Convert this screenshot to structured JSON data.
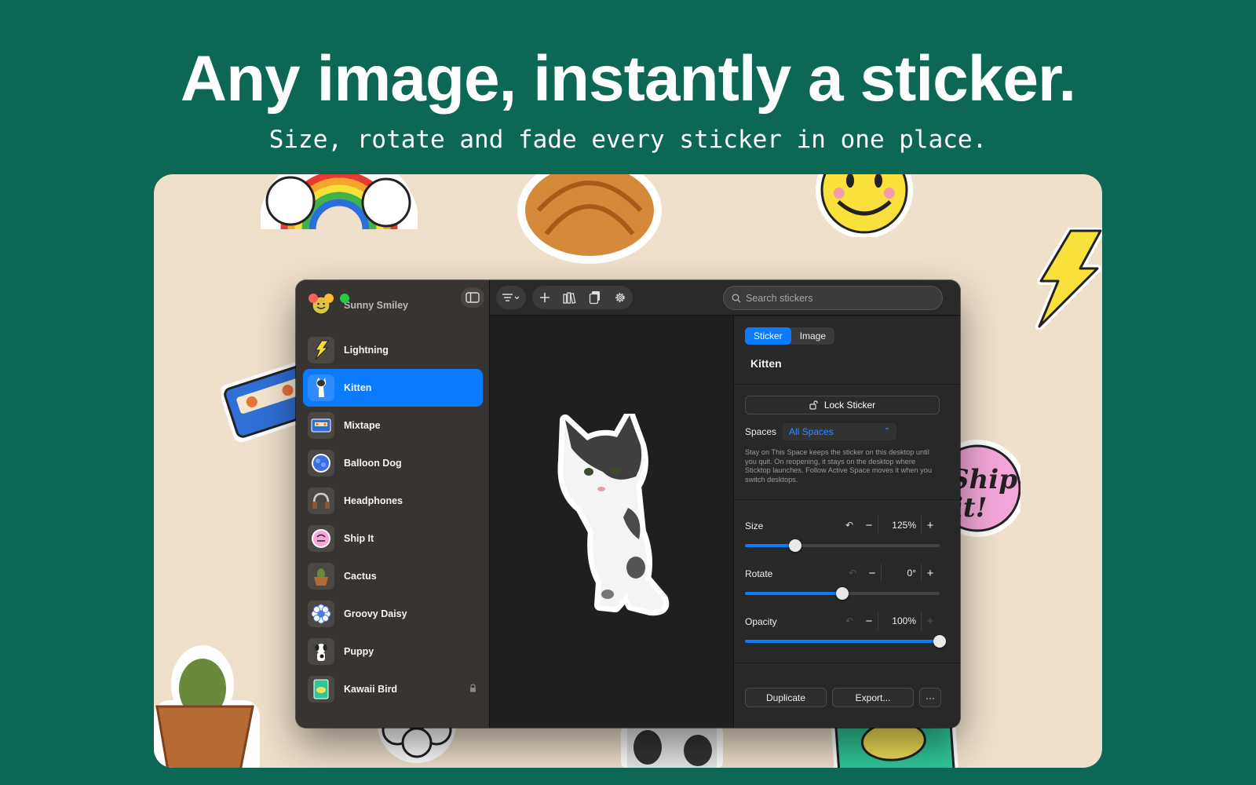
{
  "hero": {
    "headline": "Any image, instantly a sticker.",
    "subline": "Size, rotate and fade every sticker in one place."
  },
  "app": {
    "sidebar": {
      "items": [
        {
          "label": "Sunny Smiley",
          "icon": "smiley-icon",
          "active": false,
          "locked": false
        },
        {
          "label": "Lightning",
          "icon": "lightning-icon",
          "active": false,
          "locked": false
        },
        {
          "label": "Kitten",
          "icon": "kitten-icon",
          "active": true,
          "locked": false
        },
        {
          "label": "Mixtape",
          "icon": "cassette-icon",
          "active": false,
          "locked": false
        },
        {
          "label": "Balloon Dog",
          "icon": "balloon-dog-icon",
          "active": false,
          "locked": false
        },
        {
          "label": "Headphones",
          "icon": "headphones-icon",
          "active": false,
          "locked": false
        },
        {
          "label": "Ship It",
          "icon": "ship-it-icon",
          "active": false,
          "locked": false
        },
        {
          "label": "Cactus",
          "icon": "cactus-icon",
          "active": false,
          "locked": false
        },
        {
          "label": "Groovy Daisy",
          "icon": "daisy-icon",
          "active": false,
          "locked": false
        },
        {
          "label": "Puppy",
          "icon": "puppy-icon",
          "active": false,
          "locked": false
        },
        {
          "label": "Kawaii Bird",
          "icon": "bird-icon",
          "active": false,
          "locked": true
        }
      ]
    },
    "toolbar": {
      "search_placeholder": "Search stickers",
      "icons": [
        "filter-icon",
        "add-icon",
        "library-icon",
        "paste-icon",
        "settings-icon"
      ]
    },
    "inspector": {
      "tabs": [
        "Sticker",
        "Image"
      ],
      "active_tab": "Sticker",
      "title": "Kitten",
      "lock_label": "Lock Sticker",
      "spaces_label": "Spaces",
      "spaces_value": "All Spaces",
      "help_text": "Stay on This Space keeps the sticker on this desktop until you quit. On reopening, it stays on the desktop where Sticktop launches. Follow Active Space moves it when you switch desktops.",
      "size": {
        "label": "Size",
        "display": "125%",
        "fraction": 0.26
      },
      "rotate": {
        "label": "Rotate",
        "display": "0°",
        "fraction": 0.5
      },
      "opacity": {
        "label": "Opacity",
        "display": "100%",
        "fraction": 1.0
      },
      "duplicate_label": "Duplicate",
      "export_label": "Export...",
      "more_label": "···"
    }
  },
  "colors": {
    "background": "#0c6755",
    "desk": "#efe0cc",
    "accent": "#0a7aff"
  }
}
